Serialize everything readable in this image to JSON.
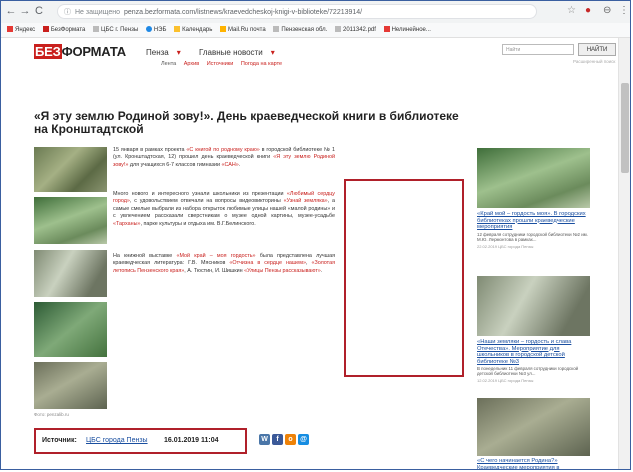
{
  "browser": {
    "secure_label": "Не защищено",
    "url": "penza.bezformata.com/listnews/kraevedcheskoj-knigi-v-biblioteke/72213914/",
    "bookmarks": [
      "Яндекс",
      "БезФормата",
      "ЦБС г. Пензы",
      "НЭБ",
      "Календарь",
      "Mail.Ru почта",
      "Пензенская обл.",
      "2011342.pdf",
      "Нелинейное..."
    ]
  },
  "site": {
    "logo_bez": "БЕЗ",
    "logo_formata": "ФОРМАТА",
    "nav": [
      "Пенза",
      "Главные новости"
    ],
    "subnav": [
      "Лента",
      "Архив",
      "Источники",
      "Погода на карте"
    ],
    "search_placeholder": "Найти",
    "search_button": "НАЙТИ",
    "search_hint": "Расширенный поиск"
  },
  "article": {
    "title": "«Я эту землю Родиной зову!». День краеведческой книги в библиотеке на Кронштадтской",
    "p1_a": "15 января в рамках проекта ",
    "p1_link": "«С книгой по родному краю»",
    "p1_b": " в городской библиотеке № 1 (ул. Кронштадтская, 12) прошел день краеведческой книги ",
    "p1_link2": "«Я эту землю Родиной зову!»",
    "p1_c": " для учащихся 6-7 классов гимназии ",
    "p1_link3": "«САН»",
    "p1_d": ".",
    "p2_a": "Много нового и интересного узнали школьники из презентации ",
    "p2_link": "«Любимый сердцу город»",
    "p2_b": ", с удовольствием отвечали на вопросы видеовикторины ",
    "p2_link2": "«Узнай земляка»",
    "p2_c": ", а самые смелые выбрали из набора открыток любимые улицы нашей «малой родины» и с увлечением рассказали сверстникам о музее одной картины, музее-усадьбе ",
    "p2_link3": "«Тарханы»",
    "p2_d": ", парке культуры и отдыха им. В.Г.Белинского.",
    "p3_a": "На книжной выставке ",
    "p3_link": "«Мой край – моя гордость»",
    "p3_b": " была представлена лучшая краеведческая литература: Г.В. Мясников ",
    "p3_link2": "«Отчизна в сердце нашем»",
    "p3_c": ", ",
    "p3_link3": "«Золотая летопись Пензенского края»",
    "p3_d": ", А. Тюстин, И. Шишкин ",
    "p3_link4": "«Улицы Пензы рассказывают»",
    "p3_e": ".",
    "photo_credit": "Фото: penzalib.ru",
    "source_label": "Источник:",
    "source_name": "ЦБС города Пензы",
    "source_date": "16.01.2019 11:04"
  },
  "share": [
    {
      "label": "W",
      "color": "#4a76a8"
    },
    {
      "label": "f",
      "color": "#3b5998"
    },
    {
      "label": "o",
      "color": "#ee8208"
    },
    {
      "label": "@",
      "color": "#168de2"
    }
  ],
  "sidebar": [
    {
      "title": "«Край мой – гордость моя». В городских библиотеках прошли краеведческие мероприятия",
      "desc": "12 февраля сотрудники городской библиотеки №2 им. М.Ю. Лермонтова в рамках...",
      "meta": "22.02.2019 ЦБС города Пензы"
    },
    {
      "title": "«Наши земляки – гордость и слава Отечества». Мероприятие для школьников в городской детской библиотеке №3",
      "desc": "В понедельник 11 февраля сотрудники городской детской библиотеки №3 ул...",
      "meta": "12.02.2019 ЦБС города Пензы"
    },
    {
      "title": "«С чего начинается Родина?» Краеведческие мероприятия в",
      "desc": "",
      "meta": ""
    }
  ]
}
